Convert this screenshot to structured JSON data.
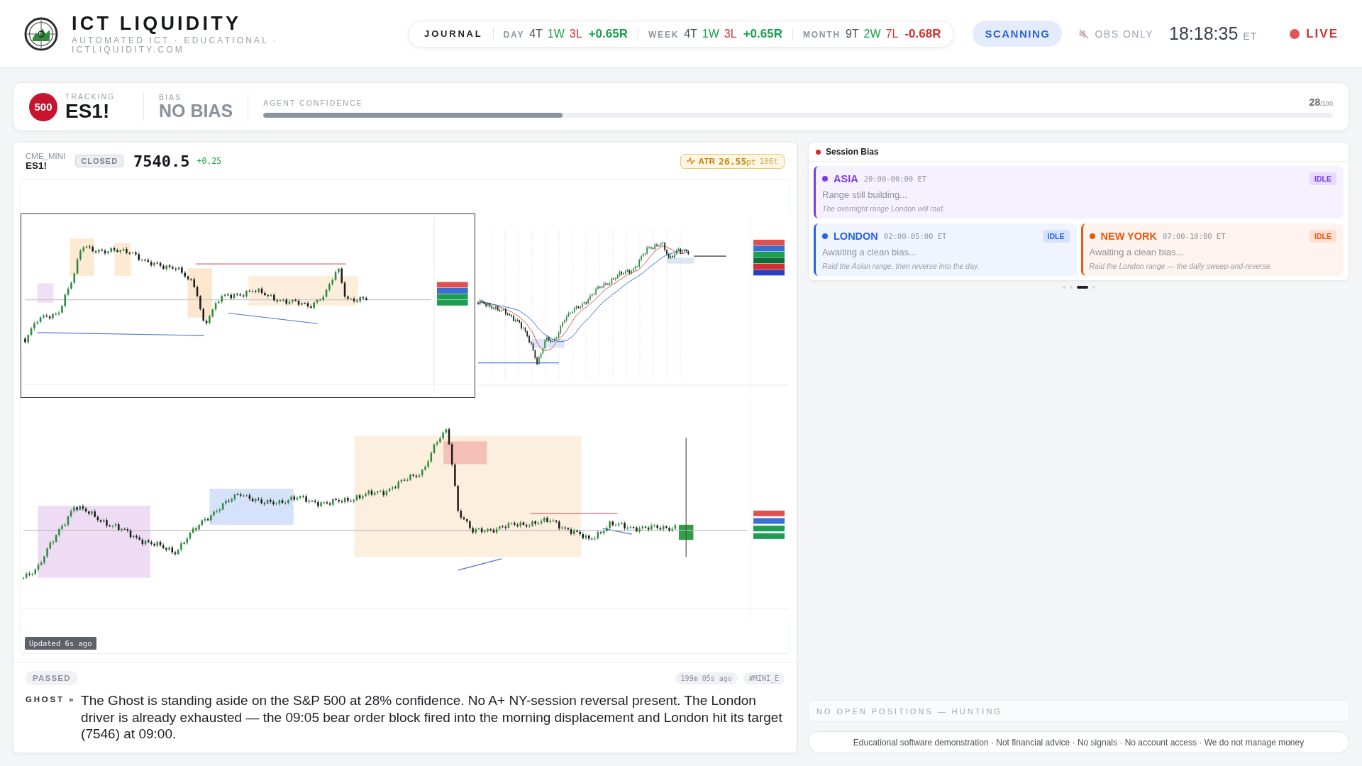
{
  "header": {
    "title": "ICT LIQUIDITY",
    "subtitle": "AUTOMATED ICT · EDUCATIONAL · ICTLIQUIDITY.COM"
  },
  "journal": {
    "label": "JOURNAL",
    "periods": [
      {
        "label": "DAY",
        "trades": "4T",
        "wins": "1W",
        "losses": "3L",
        "r": "+0.65R",
        "negative": false
      },
      {
        "label": "WEEK",
        "trades": "4T",
        "wins": "1W",
        "losses": "3L",
        "r": "+0.65R",
        "negative": false
      },
      {
        "label": "MONTH",
        "trades": "9T",
        "wins": "2W",
        "losses": "7L",
        "r": "-0.68R",
        "negative": true
      }
    ]
  },
  "status": {
    "scanning": "SCANNING",
    "mode": "OBS ONLY",
    "time": "18:18:35",
    "timezone": "ET",
    "live": "LIVE"
  },
  "tracking": {
    "badge": "500",
    "label": "TRACKING",
    "symbol": "ES1!",
    "bias_label": "BIAS",
    "bias": "NO BIAS",
    "confidence": {
      "label": "AGENT CONFIDENCE",
      "level": 0.28,
      "score": "28",
      "scale": "/100"
    }
  },
  "instrument": {
    "exchange": "CME_MINI",
    "symbol": "ES1!",
    "market": "CLOSED",
    "price": "7540.5",
    "change": "+0.25",
    "atr": {
      "label": "ATR",
      "value": "26.55",
      "unit": "pt",
      "ticks": "106t"
    }
  },
  "chart": {
    "updated": "Updated 6s ago"
  },
  "verdict": {
    "status": "PASSED",
    "age": "199m 05s ago",
    "tag": "#MINI_E",
    "author": "GHOST »",
    "text": "The Ghost is standing aside on the S&P 500 at 28% confidence. No A+ NY-session reversal present. The London driver is already exhausted — the 09:05 bear order block fired into the morning displacement and London hit its target (7546) at 09:00."
  },
  "session_bias": {
    "title": "Session Bias",
    "sessions": [
      {
        "name": "ASIA",
        "hours": "20:00-00:00 ET",
        "status": "IDLE",
        "message": "Range still building...",
        "note": "The overnight range London will raid.",
        "color": "#7c3aed"
      },
      {
        "name": "LONDON",
        "hours": "02:00-05:00 ET",
        "status": "IDLE",
        "message": "Awaiting a clean bias...",
        "note": "Raid the Asian range, then reverse into the day.",
        "color": "#2563eb"
      },
      {
        "name": "NEW YORK",
        "hours": "07:00-10:00 ET",
        "status": "IDLE",
        "message": "Awaiting a clean bias...",
        "note": "Raid the London range — the daily sweep-and-reverse.",
        "color": "#ea580c"
      }
    ],
    "pages": [
      {
        "selected": false
      },
      {
        "selected": false
      },
      {
        "selected": true
      },
      {
        "selected": false
      }
    ]
  },
  "positions": "NO OPEN POSITIONS — HUNTING",
  "disclaimer": "Educational software demonstration · Not financial advice · No signals · No account access · We do not manage money"
}
